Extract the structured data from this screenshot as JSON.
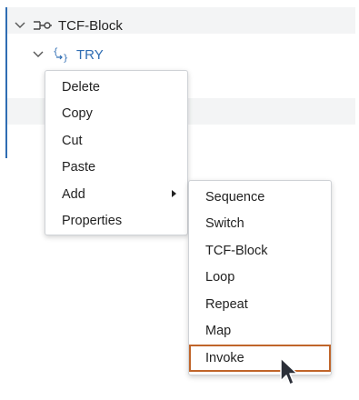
{
  "tree": {
    "rows": [
      {
        "label": "TCF-Block",
        "icon": "tcf-block-icon",
        "expanded": true
      },
      {
        "label": "TRY",
        "icon": "try-braces-icon",
        "expanded": true
      }
    ]
  },
  "context_menu": {
    "items": [
      {
        "label": "Delete"
      },
      {
        "label": "Copy"
      },
      {
        "label": "Cut"
      },
      {
        "label": "Paste"
      },
      {
        "label": "Add",
        "has_submenu": true
      },
      {
        "label": "Properties"
      }
    ]
  },
  "submenu": {
    "items": [
      {
        "label": "Sequence"
      },
      {
        "label": "Switch"
      },
      {
        "label": "TCF-Block"
      },
      {
        "label": "Loop"
      },
      {
        "label": "Repeat"
      },
      {
        "label": "Map"
      },
      {
        "label": "Invoke",
        "highlighted": true
      }
    ]
  },
  "colors": {
    "accent": "#2f6db3",
    "highlight": "#c0652a"
  }
}
